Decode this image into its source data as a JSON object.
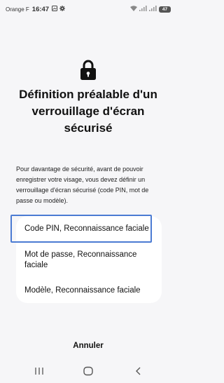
{
  "status_bar": {
    "carrier": "Orange F",
    "time": "16:47",
    "battery": "47"
  },
  "header": {
    "title": "Définition préalable d'un verrouillage d'écran sécurisé"
  },
  "description": "Pour davantage de sécurité, avant de pouvoir enregistrer votre visage, vous devez définir un verrouillage d'écran sécurisé (code PIN, mot de passe ou modèle).",
  "options": [
    {
      "label": "Code PIN, Reconnaissance faciale"
    },
    {
      "label": "Mot de passe, Reconnaissance faciale"
    },
    {
      "label": "Modèle, Reconnaissance faciale"
    }
  ],
  "actions": {
    "cancel_label": "Annuler"
  },
  "colors": {
    "background": "#f6f6f8",
    "card": "#ffffff",
    "highlight": "#4b7bd3"
  },
  "icons": [
    "image-icon",
    "gear-icon",
    "wifi-icon",
    "signal-icon",
    "battery-icon",
    "lock-icon",
    "recents-icon",
    "home-icon",
    "back-icon"
  ]
}
